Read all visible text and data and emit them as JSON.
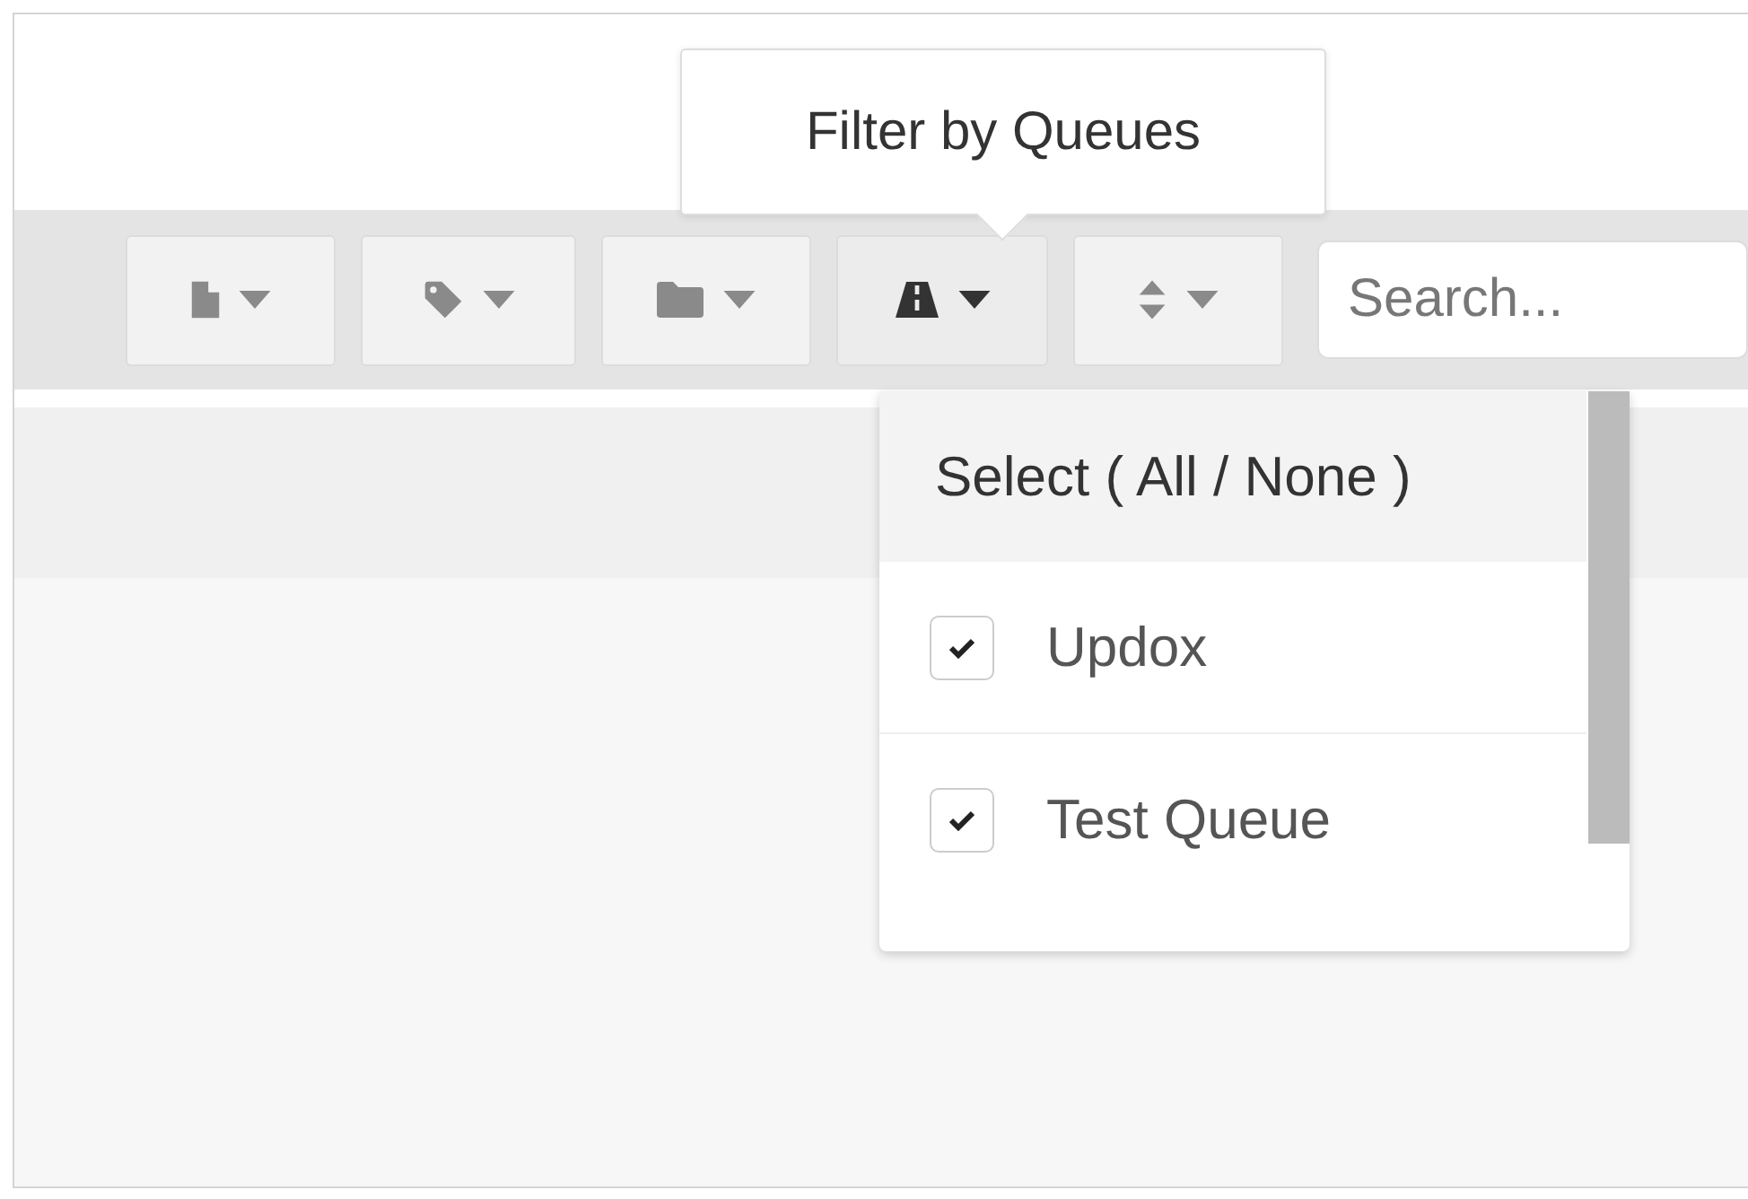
{
  "tooltip": {
    "text": "Filter by Queues"
  },
  "toolbar": {
    "buttons": [
      {
        "kind": "document",
        "selected": false
      },
      {
        "kind": "tag",
        "selected": false
      },
      {
        "kind": "folder",
        "selected": false
      },
      {
        "kind": "road",
        "selected": true
      },
      {
        "kind": "sort",
        "selected": false
      }
    ],
    "search": {
      "placeholder": "Search..."
    }
  },
  "dropdown": {
    "header": "Select ( All / None )",
    "items": [
      {
        "label": "Updox",
        "checked": true
      },
      {
        "label": "Test Queue",
        "checked": true
      }
    ]
  }
}
